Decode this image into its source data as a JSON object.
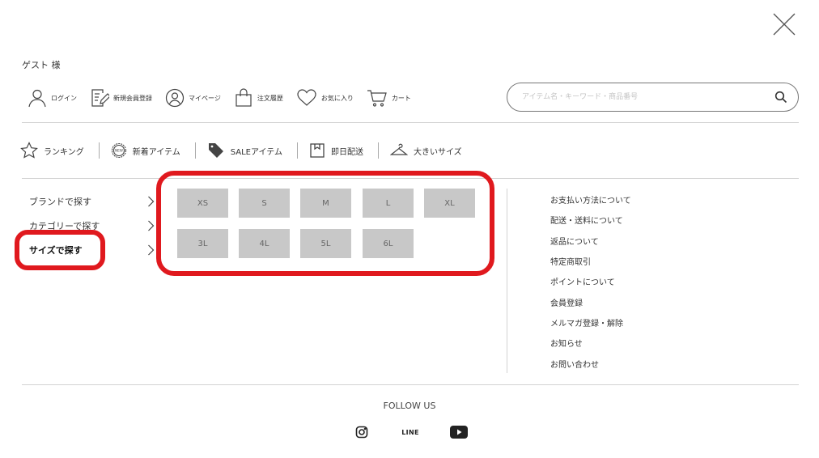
{
  "greeting": "ゲスト 様",
  "user_nav": [
    {
      "label": "ログイン",
      "icon": "person-icon"
    },
    {
      "label": "新規会員登録",
      "icon": "register-icon"
    },
    {
      "label": "マイページ",
      "icon": "mypage-icon"
    },
    {
      "label": "注文履歴",
      "icon": "bag-icon"
    },
    {
      "label": "お気に入り",
      "icon": "heart-icon"
    },
    {
      "label": "カート",
      "icon": "cart-icon"
    }
  ],
  "search": {
    "placeholder": "アイテム名・キーワード・商品番号"
  },
  "category_nav": [
    {
      "label": "ランキング",
      "icon": "star-icon"
    },
    {
      "label": "新着アイテム",
      "icon": "new-badge-icon"
    },
    {
      "label": "SALEアイテム",
      "icon": "sale-tag-icon"
    },
    {
      "label": "即日配送",
      "icon": "box-icon"
    },
    {
      "label": "大きいサイズ",
      "icon": "hanger-icon"
    }
  ],
  "left_menu": [
    {
      "label": "ブランドで探す"
    },
    {
      "label": "カテゴリーで探す"
    },
    {
      "label": "サイズで探す",
      "active": true
    }
  ],
  "sizes": [
    "XS",
    "S",
    "M",
    "L",
    "XL",
    "3L",
    "4L",
    "5L",
    "6L"
  ],
  "info_links": [
    "お支払い方法について",
    "配送・送料について",
    "返品について",
    "特定商取引",
    "ポイントについて",
    "会員登録",
    "メルマガ登録・解除",
    "お知らせ",
    "お問い合わせ"
  ],
  "footer": {
    "follow_label": "FOLLOW US",
    "line_label": "LINE"
  },
  "colors": {
    "highlight": "#e0191e",
    "size_button_bg": "#c8c8c8",
    "divider": "#d2d2d2"
  }
}
